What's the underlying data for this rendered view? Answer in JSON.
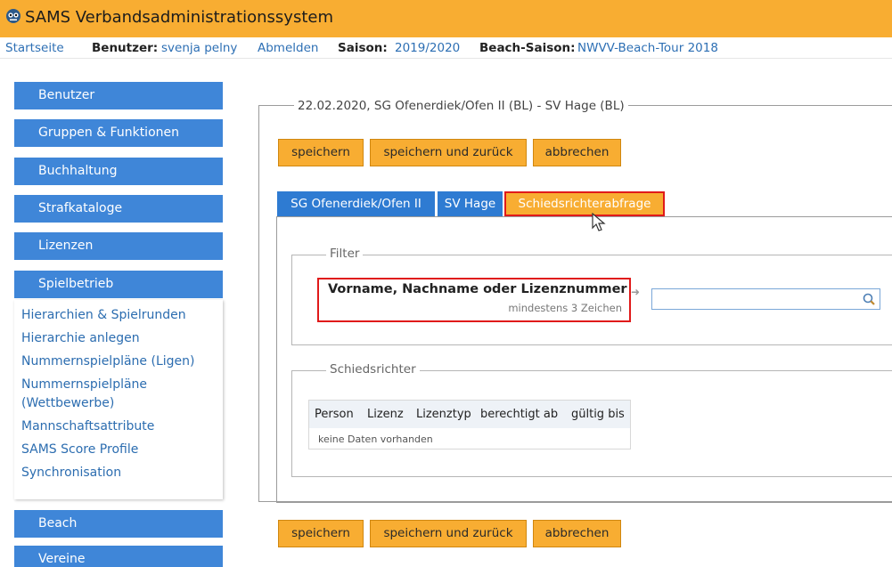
{
  "app": {
    "title": "SAMS Verbandsadministrationssystem"
  },
  "nav": {
    "home": "Startseite",
    "user_label": "Benutzer:",
    "user_name": "svenja pelny",
    "logout": "Abmelden",
    "season_label": "Saison:",
    "season_value": "2019/2020",
    "beach_label": "Beach-Saison:",
    "beach_value": "NWVV-Beach-Tour 2018"
  },
  "sidebar": {
    "top_items": [
      "Benutzer",
      "Gruppen & Funktionen",
      "Buchhaltung",
      "Strafkataloge",
      "Lizenzen",
      "Spielbetrieb"
    ],
    "sub_items": [
      "Hierarchien & Spielrunden",
      "Hierarchie anlegen",
      "Nummernspielpläne (Ligen)",
      "Nummernspielpläne",
      "(Wettbewerbe)",
      "Mannschaftsattribute",
      "SAMS Score Profile",
      "Synchronisation"
    ],
    "bottom_items": [
      "Beach",
      "Vereine"
    ]
  },
  "match": {
    "legend": "22.02.2020, SG Ofenerdiek/Ofen II (BL) - SV Hage (BL)"
  },
  "actions": {
    "save": "speichern",
    "save_back": "speichern und zurück",
    "cancel": "abbrechen"
  },
  "tabs": [
    "SG Ofenerdiek/Ofen II",
    "SV Hage",
    "Schiedsrichterabfrage"
  ],
  "filter": {
    "legend": "Filter",
    "label": "Vorname, Nachname oder Lizenznummer",
    "hint": "mindestens 3 Zeichen",
    "value": ""
  },
  "referees": {
    "legend": "Schiedsrichter",
    "columns": [
      "Person",
      "Lizenz",
      "Lizenztyp",
      "berechtigt ab",
      "gültig bis"
    ],
    "empty": "keine Daten vorhanden"
  },
  "colors": {
    "orange": "#f8ad32",
    "blue": "#3f86d8",
    "highlight": "#e01a1a"
  }
}
